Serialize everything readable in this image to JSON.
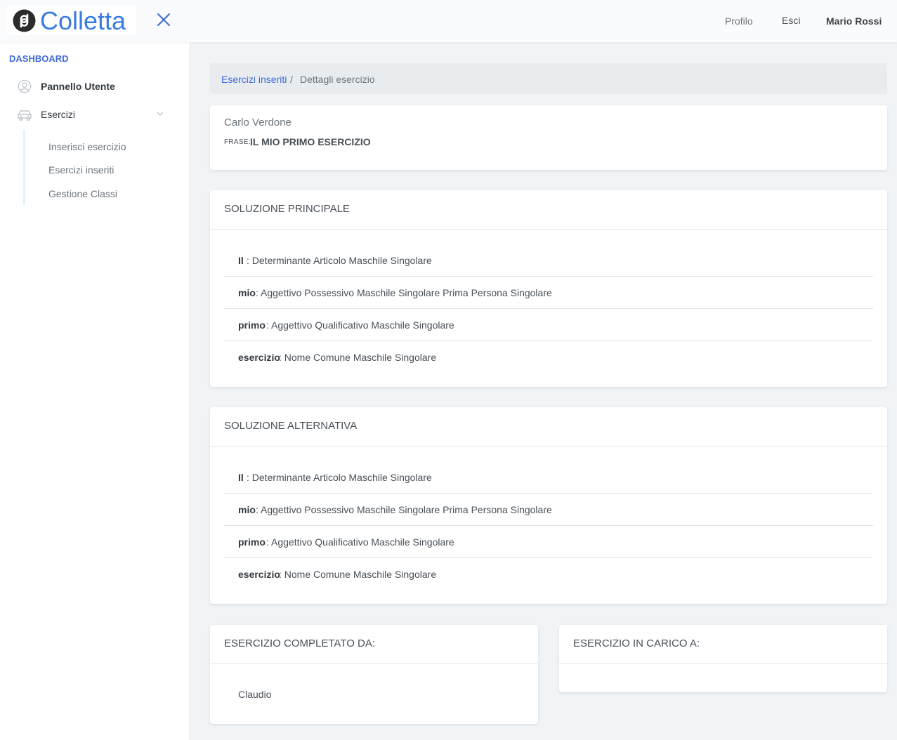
{
  "header": {
    "logo_text": "Colletta",
    "nav": {
      "profile": "Profilo",
      "logout": "Esci",
      "user": "Mario Rossi"
    }
  },
  "sidebar": {
    "heading": "DASHBOARD",
    "items": [
      {
        "label": "Pannello Utente",
        "icon": "user-circle-icon"
      },
      {
        "label": "Esercizi",
        "icon": "car-icon"
      }
    ],
    "sub_items": [
      "Inserisci esercizio",
      "Esercizi inseriti",
      "Gestione Classi"
    ]
  },
  "breadcrumb": {
    "link": "Esercizi inseriti",
    "separator": "/",
    "current": "Dettagli esercizio"
  },
  "exercise": {
    "author": "Carlo Verdone",
    "frase_label": "FRASE:",
    "frase": "IL MIO PRIMO ESERCIZIO"
  },
  "main_solution": {
    "title": "SOLUZIONE PRINCIPALE",
    "rows": [
      {
        "word": "Il",
        "desc": " : Determinante Articolo Maschile Singolare"
      },
      {
        "word": "mio",
        "desc": " : Aggettivo Possessivo Maschile Singolare Prima Persona Singolare"
      },
      {
        "word": "primo",
        "desc": " : Aggettivo Qualificativo Maschile Singolare"
      },
      {
        "word": "esercizio",
        "desc": " : Nome Comune Maschile Singolare"
      }
    ]
  },
  "alt_solution": {
    "title": "SOLUZIONE ALTERNATIVA",
    "rows": [
      {
        "word": "Il",
        "desc": " : Determinante Articolo Maschile Singolare"
      },
      {
        "word": "mio",
        "desc": " : Aggettivo Possessivo Maschile Singolare Prima Persona Singolare"
      },
      {
        "word": "primo",
        "desc": " : Aggettivo Qualificativo Maschile Singolare"
      },
      {
        "word": "esercizio",
        "desc": " : Nome Comune Maschile Singolare"
      }
    ]
  },
  "completed_by": {
    "title": "ESERCIZIO COMPLETATO DA:",
    "names": [
      "Claudio"
    ]
  },
  "assigned_to": {
    "title": "ESERCIZIO IN CARICO A:",
    "names": []
  },
  "colors": {
    "accent": "#3f6ad8",
    "logo": "#3a7be0",
    "background": "#f1f4f6"
  }
}
